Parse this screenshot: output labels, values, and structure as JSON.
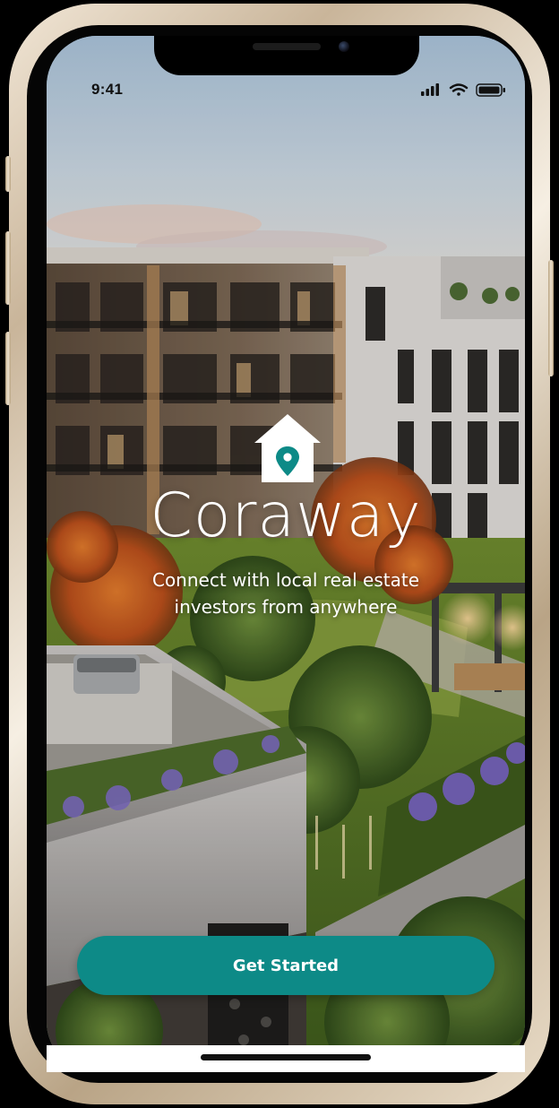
{
  "status_bar": {
    "time": "9:41",
    "signal_icon": "cellular-signal-icon",
    "wifi_icon": "wifi-icon",
    "battery_icon": "battery-icon"
  },
  "brand": {
    "icon": "home-location-pin-icon",
    "name": "Coraway",
    "tagline_line1": "Connect with local real estate",
    "tagline_line2": "investors from anywhere"
  },
  "cta": {
    "label": "Get Started"
  },
  "colors": {
    "accent": "#0d8a87",
    "text_on_image": "#ffffff",
    "device_frame": "#e4d6c1"
  }
}
